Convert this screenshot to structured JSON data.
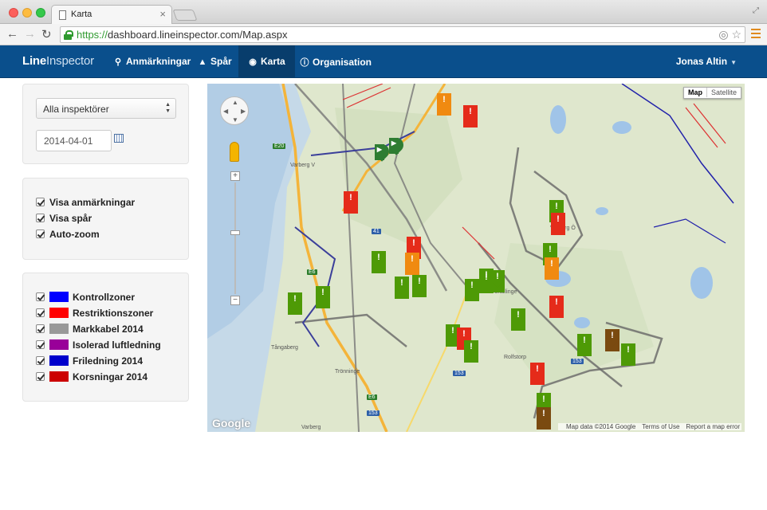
{
  "browser": {
    "tab_title": "Karta",
    "url_scheme": "https://",
    "url_rest": "dashboard.lineinspector.com/Map.aspx"
  },
  "navbar": {
    "brand_bold": "Line",
    "brand_light": "Inspector",
    "items": [
      {
        "label": "Anmärkningar",
        "icon": "map-marker-icon"
      },
      {
        "label": "Spår",
        "icon": "road-icon"
      },
      {
        "label": "Karta",
        "icon": "globe-icon",
        "active": true
      },
      {
        "label": "Organisation",
        "icon": "info-icon"
      }
    ],
    "user": "Jonas Altin"
  },
  "filters": {
    "inspector_select": "Alla inspektörer",
    "date": "2014-04-01"
  },
  "options": [
    {
      "label": "Visa anmärkningar",
      "checked": true
    },
    {
      "label": "Visa spår",
      "checked": true
    },
    {
      "label": "Auto-zoom",
      "checked": true
    }
  ],
  "layers": [
    {
      "label": "Kontrollzoner",
      "color": "#0000ff",
      "checked": true
    },
    {
      "label": "Restriktionszoner",
      "color": "#ff0000",
      "checked": true
    },
    {
      "label": "Markkabel 2014",
      "color": "#999999",
      "checked": true
    },
    {
      "label": "Isolerad luftledning",
      "color": "#990099",
      "checked": true
    },
    {
      "label": "Friledning 2014",
      "color": "#0000cc",
      "checked": true
    },
    {
      "label": "Korsningar 2014",
      "color": "#cc0000",
      "checked": true
    }
  ],
  "map": {
    "type_map": "Map",
    "type_satellite": "Satellite",
    "logo": "Google",
    "attribution": "Map data ©2014 Google",
    "terms": "Terms of Use",
    "report": "Report a map error",
    "places": [
      "Varberg V",
      "Varberg Ö",
      "Tångaberg",
      "Trönninge",
      "Skällinge",
      "Rolfstorp",
      "Varberg"
    ],
    "roads": [
      "E20",
      "E6",
      "E6",
      "153",
      "153",
      "153",
      "41"
    ],
    "marker_colors": {
      "green": "#4e9a06",
      "red": "#e52b1a",
      "orange": "#f08a10",
      "brown": "#7a4a10"
    }
  }
}
